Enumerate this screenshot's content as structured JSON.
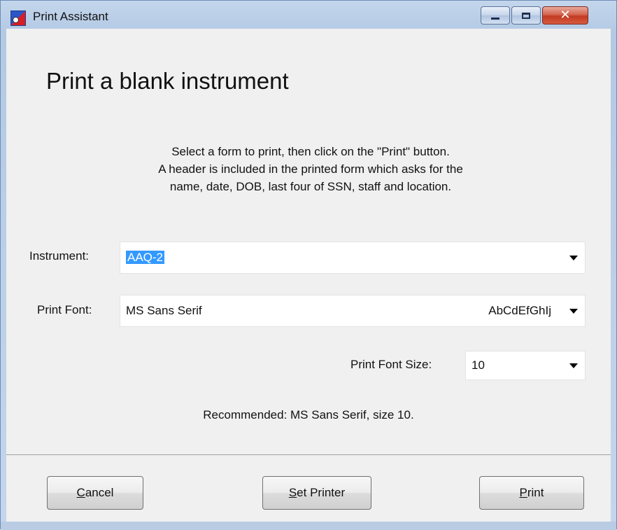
{
  "window": {
    "title": "Print Assistant",
    "icon": "app-logo-icon",
    "controls": {
      "minimize": "minimize-icon",
      "maximize": "maximize-icon",
      "close": "close-icon"
    },
    "close_glyph": "✕"
  },
  "heading": "Print a blank instrument",
  "instructions": [
    "Select a form to print, then click on the \"Print\" button.",
    "A header is included in the printed form which asks for the",
    "name, date, DOB, last four of SSN, staff and location."
  ],
  "instrument": {
    "label": "Instrument:",
    "value": "AAQ-2"
  },
  "print_font": {
    "label": "Print Font:",
    "value": "MS Sans Serif",
    "sample": "AbCdEfGhIj"
  },
  "print_font_size": {
    "label": "Print Font Size:",
    "value": "10"
  },
  "recommended": "Recommended: MS Sans Serif, size 10.",
  "buttons": {
    "cancel": {
      "mnemonic": "C",
      "rest": "ancel"
    },
    "set_printer": {
      "mnemonic": "S",
      "rest": "et Printer"
    },
    "print": {
      "mnemonic": "P",
      "rest": "rint"
    }
  },
  "colors": {
    "selection": "#3399ff",
    "close_button": "#c23b22",
    "frame": "#b3c9e4"
  }
}
